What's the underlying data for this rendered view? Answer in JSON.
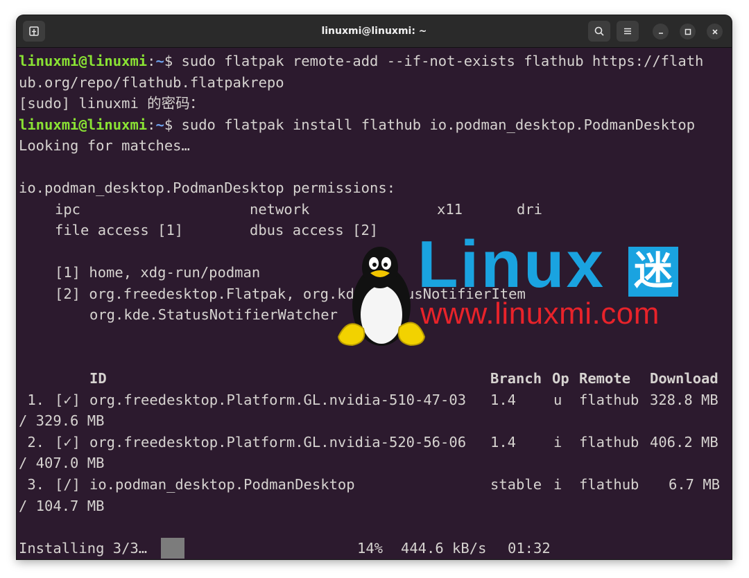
{
  "window": {
    "title": "linuxmi@linuxmi: ~"
  },
  "prompt": {
    "user": "linuxmi@linuxmi",
    "sep": ":",
    "path": "~",
    "dollar": "$ "
  },
  "lines": {
    "l1_cmd": "sudo flatpak remote-add --if-not-exists flathub https://flath",
    "l2": "ub.org/repo/flathub.flatpakrepo",
    "l3": "[sudo] linuxmi 的密码：",
    "l4_cmd": "sudo flatpak install flathub io.podman_desktop.PodmanDesktop",
    "l5": "Looking for matches…",
    "l7": "io.podman_desktop.PodmanDesktop permissions:",
    "perm_ipc": "ipc",
    "perm_network": "network",
    "perm_x11": "x11",
    "perm_dri": "dri",
    "perm_file": "file access [1]",
    "perm_dbus": "dbus access [2]",
    "note1": "[1] home, xdg-run/podman",
    "note2": "[2] org.freedesktop.Flatpak, org.kde.StatusNotifierItem",
    "note2b": "org.kde.StatusNotifierWatcher"
  },
  "table": {
    "headers": {
      "id": "ID",
      "branch": "Branch",
      "op": "Op",
      "remote": "Remote",
      "download": "Download"
    },
    "rows": [
      {
        "num": " 1.",
        "status": "[✓]",
        "id": "org.freedesktop.Platform.GL.nvidia-510-47-03",
        "branch": "1.4",
        "op": "u",
        "remote": "flathub",
        "download": "328.8 MB",
        "total": "/ 329.6 MB"
      },
      {
        "num": " 2.",
        "status": "[✓]",
        "id": "org.freedesktop.Platform.GL.nvidia-520-56-06",
        "branch": "1.4",
        "op": "i",
        "remote": "flathub",
        "download": "406.2 MB",
        "total": "/ 407.0 MB"
      },
      {
        "num": " 3.",
        "status": "[/]",
        "id": "io.podman_desktop.PodmanDesktop",
        "branch": "stable",
        "op": "i",
        "remote": "flathub",
        "download": "6.7 MB",
        "total": "/ 104.7 MB"
      }
    ]
  },
  "progress": {
    "label": "Installing 3/3…",
    "percent": "14%",
    "rate": "444.6 kB/s",
    "eta": "01:32"
  },
  "watermark": {
    "logo_text": "Linux",
    "logo_char": "迷",
    "url": "www.linuxmi.com"
  },
  "icons": {
    "new_tab": "new-tab-icon",
    "search": "search-icon",
    "menu": "hamburger-menu-icon",
    "minimize": "minimize-icon",
    "maximize": "maximize-icon",
    "close": "close-icon",
    "mascot": "tux-penguin-icon"
  },
  "colors": {
    "terminal_bg": "#2c1a2e",
    "prompt_user": "#8ae234",
    "prompt_path": "#6fa3ef",
    "watermark_blue": "#1aa3e0",
    "watermark_red": "#e8232a"
  }
}
